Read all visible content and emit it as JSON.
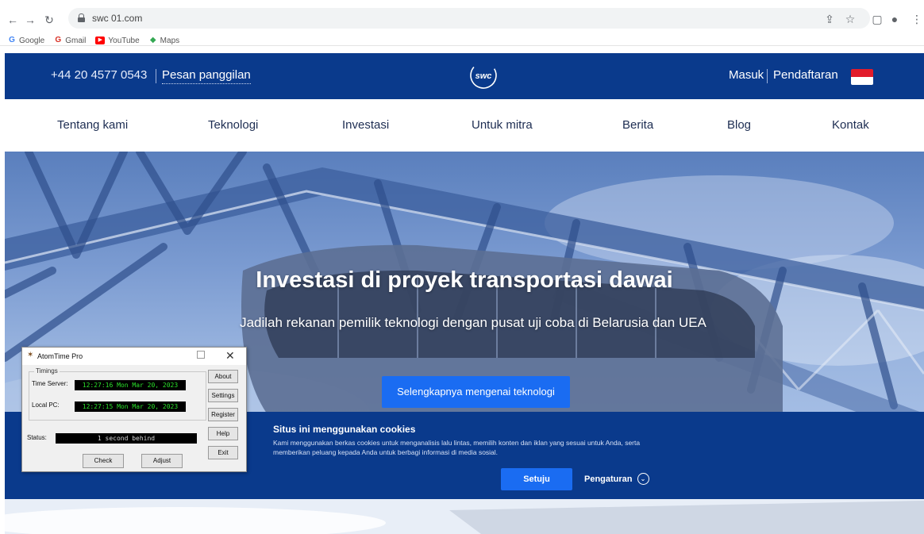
{
  "browser": {
    "url": "swc 01.com",
    "bookmarks": [
      {
        "label": "Google",
        "icon": "google-icon",
        "color": "#4285f4"
      },
      {
        "label": "Gmail",
        "icon": "gmail-icon",
        "color": "#d93025"
      },
      {
        "label": "YouTube",
        "icon": "youtube-icon",
        "color": "#ff0000"
      },
      {
        "label": "Maps",
        "icon": "maps-icon",
        "color": "#34a853"
      }
    ]
  },
  "site": {
    "phone": "+44 20 4577 0543",
    "callback": "Pesan panggilan",
    "login": "Masuk",
    "register": "Pendaftaran",
    "nav": [
      "Tentang kami",
      "Teknologi",
      "Investasi",
      "Untuk mitra",
      "Berita",
      "Blog",
      "Kontak"
    ],
    "hero": {
      "title": "Investasi di proyek transportasi dawai",
      "subtitle": "Jadilah rekanan pemilik teknologi dengan pusat uji coba di Belarusia dan UEA",
      "button": "Selengkapnya mengenai teknologi"
    },
    "cookie": {
      "title": "Situs ini menggunakan cookies",
      "text": "Kami menggunakan berkas cookies untuk menganalisis lalu lintas, memilih konten dan iklan yang sesuai untuk Anda, serta memberikan peluang kepada Anda untuk berbagi informasi di media sosial.",
      "agree": "Setuju",
      "settings": "Pengaturan"
    },
    "colors": {
      "brand_blue": "#0a3a8c",
      "accent_blue": "#1a6cf2"
    }
  },
  "atomtime": {
    "title": "AtomTime Pro",
    "group_label": "Timings",
    "time_server_label": "Time Server:",
    "time_server_value": "12:27:16 Mon Mar 20, 2023",
    "local_pc_label": "Local PC:",
    "local_pc_value": "12:27:15 Mon Mar 20, 2023",
    "status_label": "Status:",
    "status_value": "1 second behind",
    "buttons": {
      "about": "About",
      "settings": "Settings",
      "register": "Register",
      "help": "Help",
      "exit": "Exit",
      "check": "Check",
      "adjust": "Adjust"
    }
  }
}
